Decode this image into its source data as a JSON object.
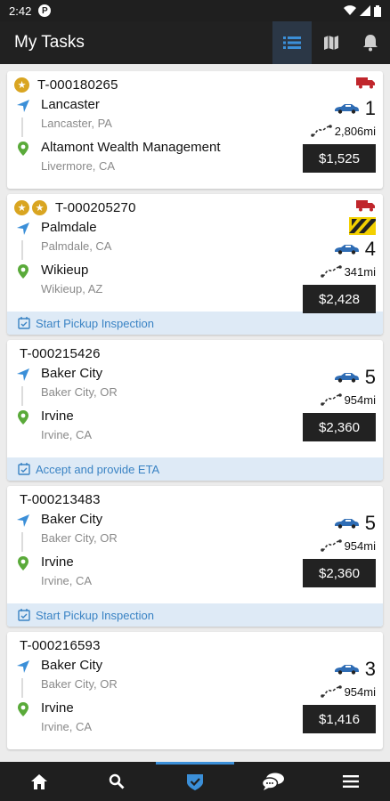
{
  "status_bar": {
    "time": "2:42",
    "app_icon_letter": "P"
  },
  "app_bar": {
    "title": "My Tasks",
    "actions": [
      "list-icon",
      "map-icon",
      "bell-icon"
    ]
  },
  "colors": {
    "accent": "#3a83c4",
    "star": "#d9a521",
    "truck": "#c0262c",
    "price_bg": "#222222",
    "action_bg": "#deeaf6"
  },
  "tasks": [
    {
      "stars": 1,
      "id": "T-000180265",
      "truck": true,
      "warning": false,
      "origin": {
        "name": "Lancaster",
        "sub": "Lancaster, PA"
      },
      "destination": {
        "name": "Altamont Wealth Management",
        "sub": "Livermore, CA"
      },
      "cars": "1",
      "distance": "2,806mi",
      "price": "$1,525",
      "action": ""
    },
    {
      "stars": 2,
      "id": "T-000205270",
      "truck": true,
      "warning": true,
      "origin": {
        "name": "Palmdale",
        "sub": "Palmdale, CA"
      },
      "destination": {
        "name": "Wikieup",
        "sub": "Wikieup, AZ"
      },
      "cars": "4",
      "distance": "341mi",
      "price": "$2,428",
      "action": "Start Pickup Inspection"
    },
    {
      "stars": 0,
      "id": "T-000215426",
      "truck": false,
      "warning": false,
      "origin": {
        "name": "Baker City",
        "sub": "Baker City, OR"
      },
      "destination": {
        "name": "Irvine",
        "sub": "Irvine, CA"
      },
      "cars": "5",
      "distance": "954mi",
      "price": "$2,360",
      "action": "Accept and provide ETA"
    },
    {
      "stars": 0,
      "id": "T-000213483",
      "truck": false,
      "warning": false,
      "origin": {
        "name": "Baker City",
        "sub": "Baker City, OR"
      },
      "destination": {
        "name": "Irvine",
        "sub": "Irvine, CA"
      },
      "cars": "5",
      "distance": "954mi",
      "price": "$2,360",
      "action": "Start Pickup Inspection"
    },
    {
      "stars": 0,
      "id": "T-000216593",
      "truck": false,
      "warning": false,
      "origin": {
        "name": "Baker City",
        "sub": "Baker City, OR"
      },
      "destination": {
        "name": "Irvine",
        "sub": "Irvine, CA"
      },
      "cars": "3",
      "distance": "954mi",
      "price": "$1,416",
      "action": ""
    }
  ],
  "bottom_nav": [
    "home-icon",
    "search-icon",
    "tasks-shield-icon",
    "chat-icon",
    "menu-icon"
  ]
}
